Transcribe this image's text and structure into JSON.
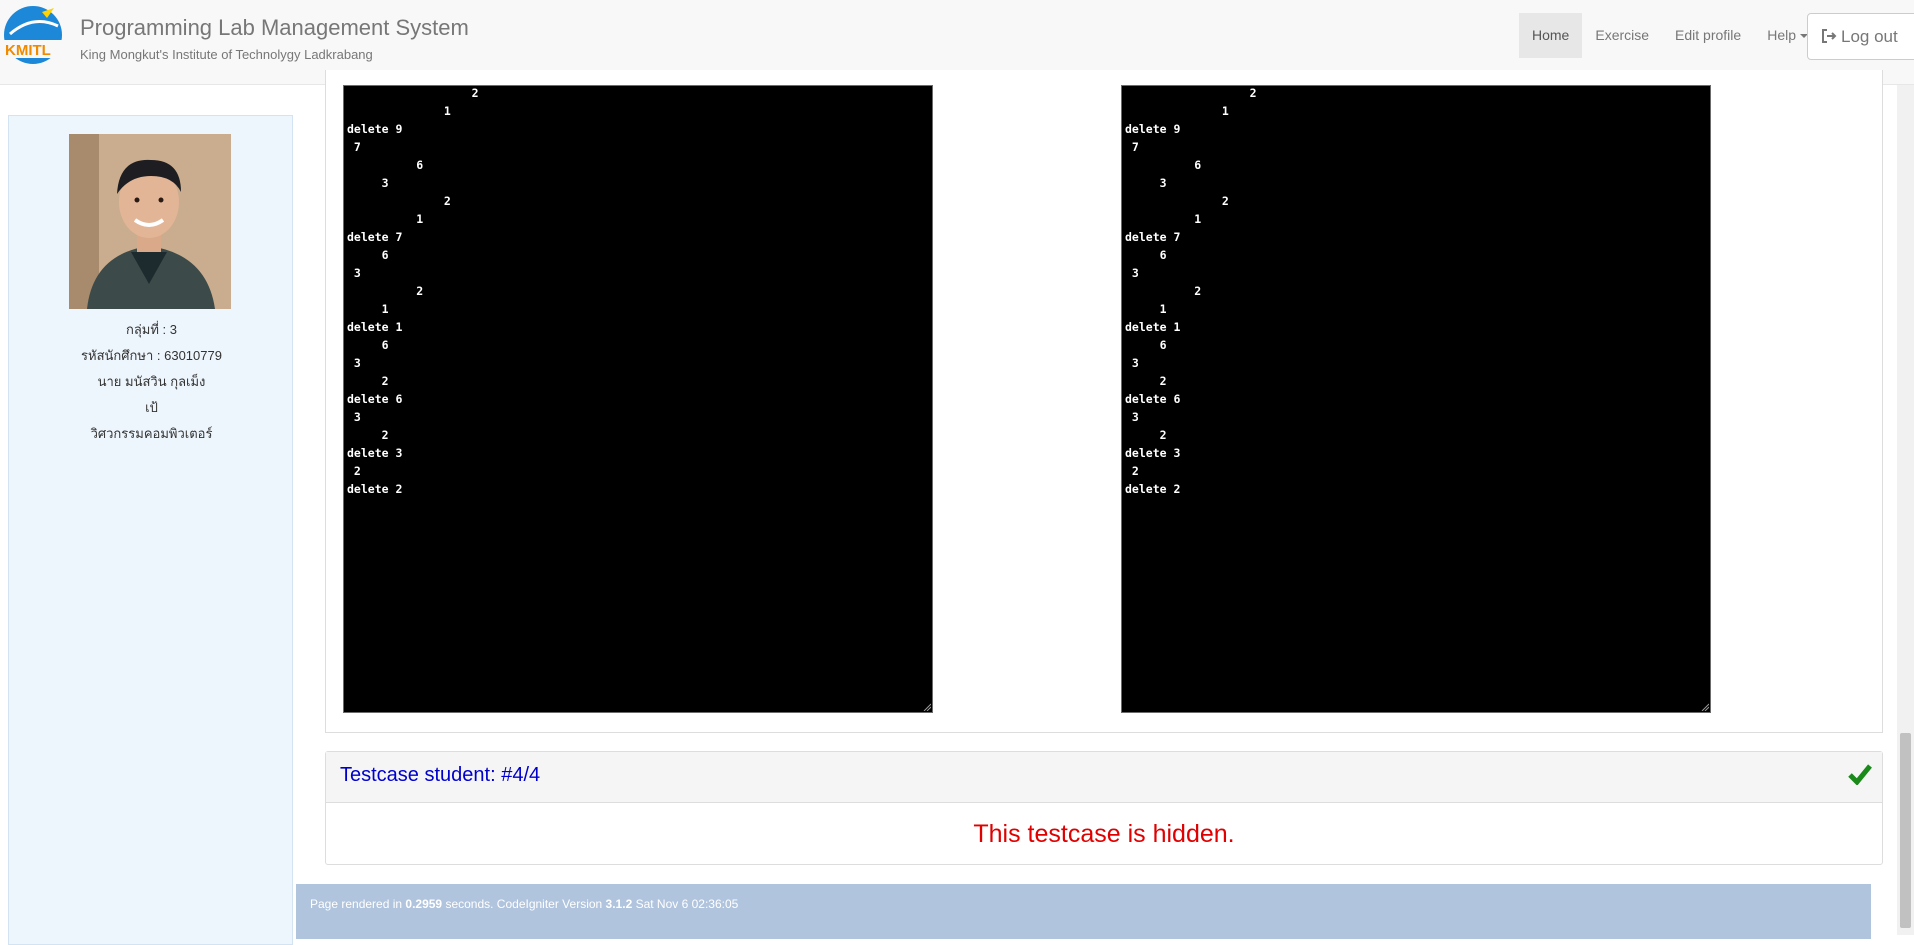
{
  "header": {
    "title": "Programming Lab Management System",
    "subtitle": "King Mongkut's Institute of Technolygy Ladkrabang",
    "logo_text": "KMITL",
    "nav": [
      {
        "label": "Home"
      },
      {
        "label": "Exercise"
      },
      {
        "label": "Edit profile"
      },
      {
        "label": "Help"
      }
    ],
    "logout_label": "Log out"
  },
  "profile": {
    "group": "กลุ่มที่ : 3",
    "student_id": "รหัสนักศึกษา : 63010779",
    "name": "นาย มนัสวิน กุลเม็ง",
    "nickname": "เป้",
    "department": "วิศวกรรมคอมพิวเตอร์"
  },
  "outputs": {
    "student_output": "                  2\n              1\ndelete 9\n 7\n          6\n     3\n              2\n          1\ndelete 7\n     6\n 3\n          2\n     1\ndelete 1\n     6\n 3\n     2\ndelete 6\n 3\n     2\ndelete 3\n 2\ndelete 2",
    "expected_output": "                  2\n              1\ndelete 9\n 7\n          6\n     3\n              2\n          1\ndelete 7\n     6\n 3\n          2\n     1\ndelete 1\n     6\n 3\n     2\ndelete 6\n 3\n     2\ndelete 3\n 2\ndelete 2"
  },
  "testcase": {
    "title": "Testcase student: #4/4",
    "hidden_message": "This testcase is hidden.",
    "status_color": "#1a8a1a"
  },
  "footer": {
    "prefix": "Page rendered in ",
    "time": "0.2959",
    "middle": " seconds. CodeIgniter Version ",
    "version": "3.1.2",
    "date": " Sat Nov 6 02:36:05"
  }
}
